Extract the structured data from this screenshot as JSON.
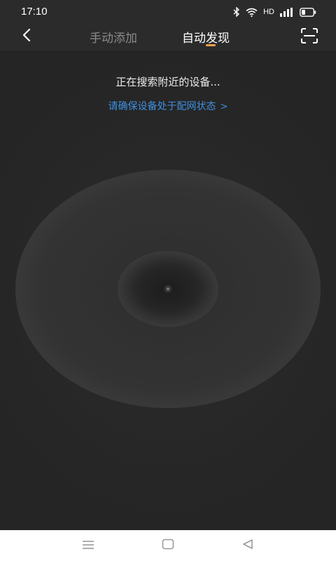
{
  "status_bar": {
    "time": "17:10",
    "network_label": "HD",
    "icons": [
      "bluetooth-icon",
      "wifi-icon",
      "cellular-signal-icon",
      "battery-icon"
    ]
  },
  "header": {
    "back_icon": "chevron-left-icon",
    "tabs": [
      {
        "label": "手动添加",
        "active": false
      },
      {
        "label": "自动发现",
        "active": true
      }
    ],
    "scan_icon": "scan-icon",
    "indicator_color": "#f0a04a"
  },
  "main": {
    "search_status": "正在搜索附近的设备...",
    "pairing_hint": "请确保设备处于配网状态",
    "pairing_hint_chevron": ">",
    "link_color": "#3d8fe0",
    "background_color": "#252525"
  },
  "nav_bar": {
    "icons": [
      "menu-icon",
      "home-icon",
      "back-triangle-icon"
    ]
  }
}
